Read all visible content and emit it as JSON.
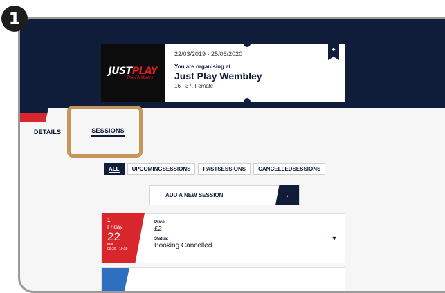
{
  "step_number": "1",
  "venue": {
    "logo_text_a": "JUST",
    "logo_text_b": "PLAY",
    "logo_sub": "The FA Mixers",
    "dates": "22/03/2019 - 25/06/2020",
    "organising_label": "You are organising at",
    "name": "Just Play Wembley",
    "meta": "16 - 37, Female",
    "flag_icon": "♣"
  },
  "tabs": [
    {
      "label": "DETAILS"
    },
    {
      "label": "SESSIONS"
    }
  ],
  "filters": [
    {
      "label": "ALL"
    },
    {
      "label": "UPCOMINGSESSIONS"
    },
    {
      "label": "PASTSESSIONS"
    },
    {
      "label": "CANCELLEDSESSIONS"
    }
  ],
  "add_session": {
    "label": "ADD A NEW SESSION",
    "arrow": "›"
  },
  "sessions": [
    {
      "number": "1",
      "day": "Friday",
      "date": "22",
      "month": "Mar",
      "time": "09:30 - 10:30",
      "price_label": "Price:",
      "price": "£2",
      "status_label": "Status:",
      "status": "Booking Cancelled",
      "caret": "▼"
    }
  ],
  "colors": {
    "navy": "#0f1d3a",
    "red": "#d9262c",
    "highlight": "#c5955a",
    "blue": "#2f6fc0"
  }
}
